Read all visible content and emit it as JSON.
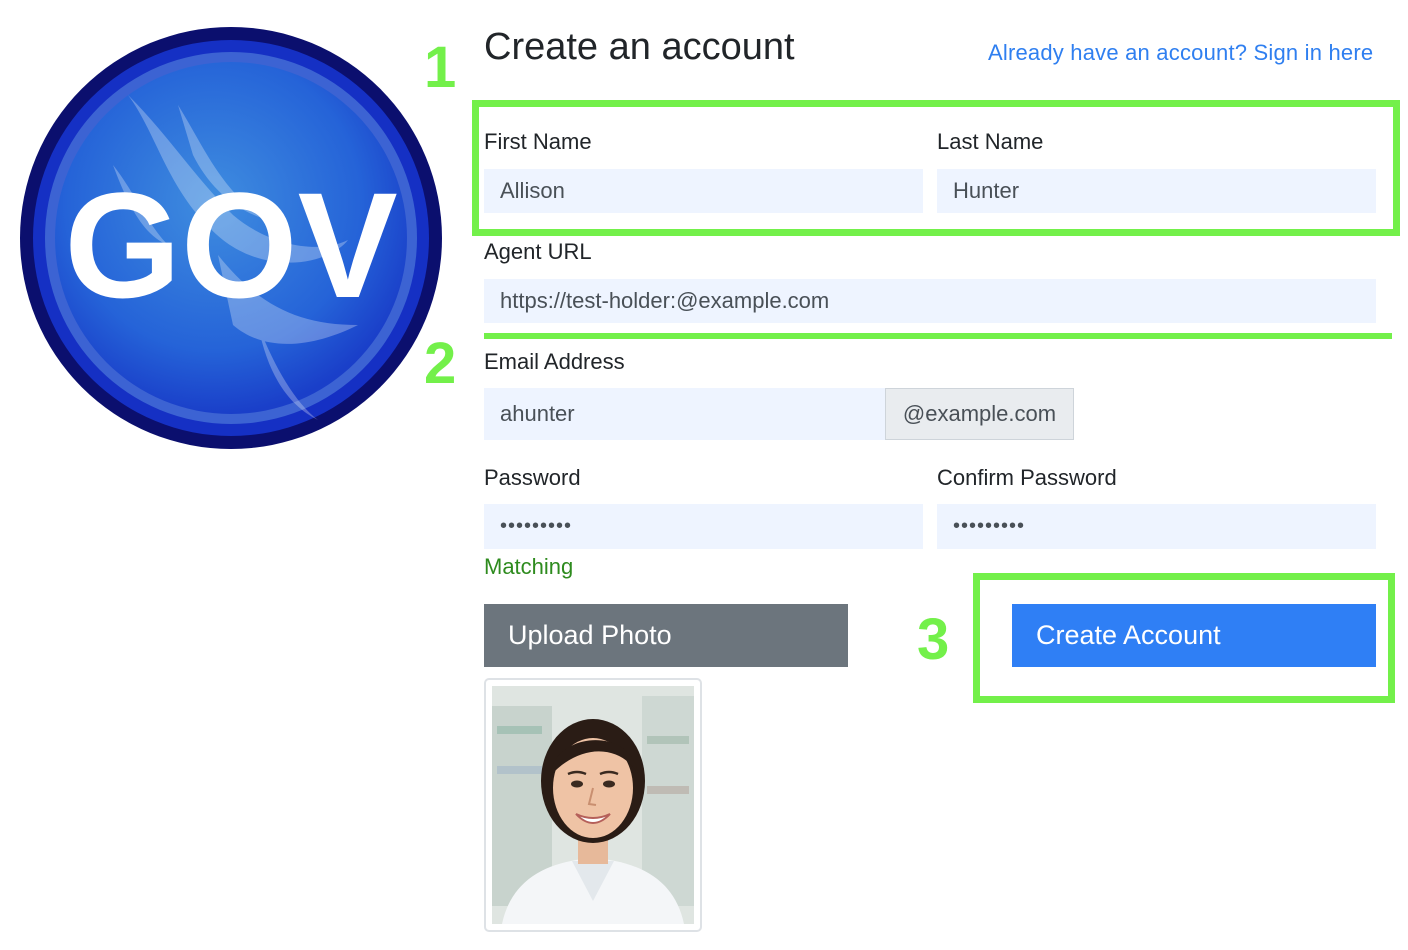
{
  "logo": {
    "text": "GOV"
  },
  "header": {
    "title": "Create an account",
    "signin_link": "Already have an account? Sign in here"
  },
  "form": {
    "first_name": {
      "label": "First Name",
      "value": "Allison"
    },
    "last_name": {
      "label": "Last Name",
      "value": "Hunter"
    },
    "agent_url": {
      "label": "Agent URL",
      "value": "https://test-holder:@example.com"
    },
    "email": {
      "label": "Email Address",
      "value": "ahunter",
      "domain": "@example.com"
    },
    "password": {
      "label": "Password",
      "value": "•••••••••"
    },
    "confirm_password": {
      "label": "Confirm Password",
      "value": "•••••••••"
    },
    "match_status": "Matching",
    "upload_label": "Upload Photo",
    "submit_label": "Create Account"
  },
  "annotations": {
    "step1": "1",
    "step2": "2",
    "step3": "3"
  },
  "colors": {
    "accent": "#2f7ff5",
    "link": "#2f7ff0",
    "secondary_button": "#6c757d",
    "input_bg": "#eef4ff",
    "success_text": "#2e8b1e",
    "annotation_green": "#73f04a",
    "logo_ring": "#101599",
    "logo_fill": "#1f4fd6"
  }
}
